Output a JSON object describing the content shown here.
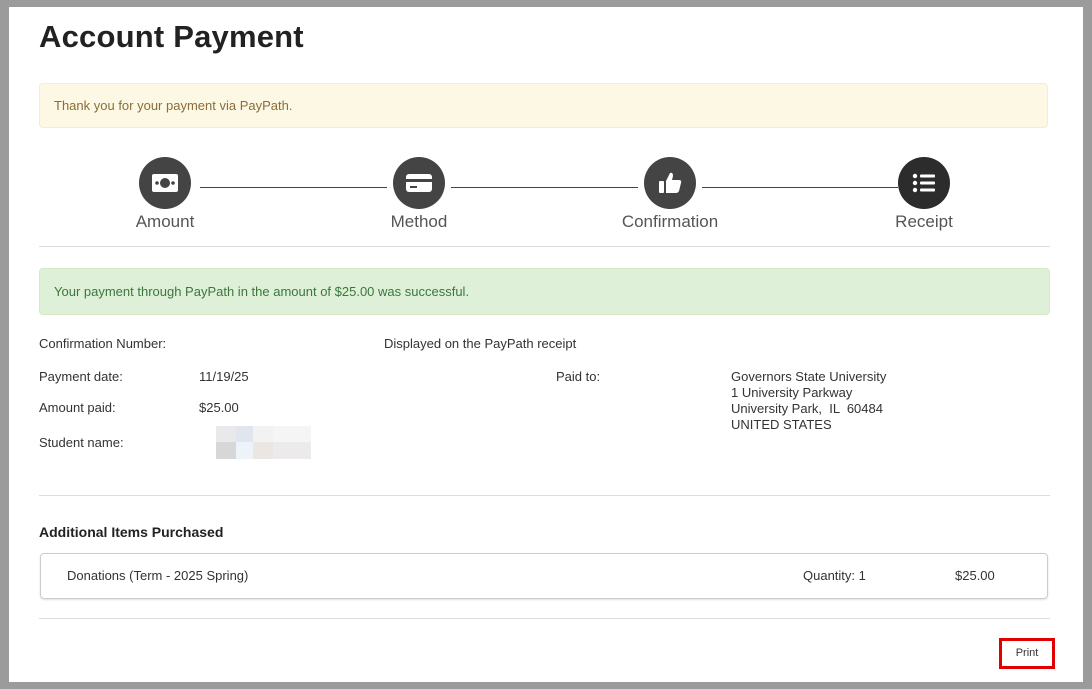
{
  "page": {
    "title": "Account Payment"
  },
  "notice": {
    "message": "Thank you for your payment via PayPath."
  },
  "steps": [
    {
      "label": "Amount",
      "icon": "money-icon"
    },
    {
      "label": "Method",
      "icon": "credit-card-icon"
    },
    {
      "label": "Confirmation",
      "icon": "thumbs-up-icon"
    },
    {
      "label": "Receipt",
      "icon": "list-icon"
    }
  ],
  "success": {
    "message": "Your payment through PayPath in the amount of $25.00 was successful."
  },
  "receipt": {
    "confirmation_label": "Confirmation Number:",
    "confirmation_value": "Displayed on the PayPath receipt",
    "payment_date_label": "Payment date:",
    "payment_date_value": "11/19/25",
    "amount_label": "Amount paid:",
    "amount_value": "$25.00",
    "student_label": "Student name:",
    "paid_to_label": "Paid to:",
    "paid_to_lines": [
      "Governors State University",
      "1 University Parkway",
      "University Park,  IL  60484",
      "UNITED STATES"
    ]
  },
  "additional_items": {
    "heading": "Additional Items Purchased",
    "items": [
      {
        "description": "Donations (Term - 2025 Spring)",
        "quantity": "Quantity: 1",
        "amount": "$25.00"
      }
    ]
  },
  "actions": {
    "print_label": "Print"
  },
  "colors": {
    "step_circle": "#444444",
    "highlight_border": "#e00000",
    "success_bg": "#dff0d8",
    "warning_bg": "#fcf8e3"
  }
}
